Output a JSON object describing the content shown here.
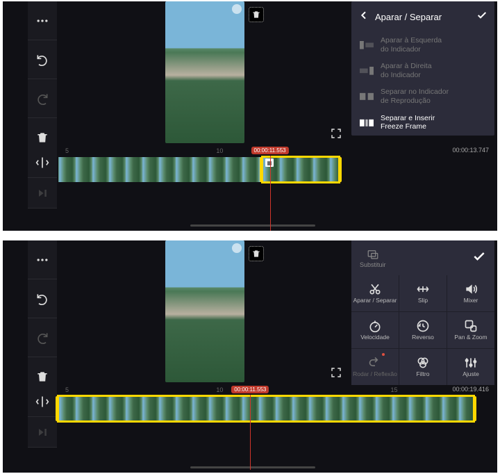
{
  "top": {
    "panel_title": "Aparar / Separar",
    "menu": [
      {
        "l1": "Aparar à Esquerda",
        "l2": "do Indicador"
      },
      {
        "l1": "Aparar à Direita",
        "l2": "do Indicador"
      },
      {
        "l1": "Separar no Indicador",
        "l2": "de Reprodução"
      },
      {
        "l1": "Separar e Inserir",
        "l2": "Freeze Frame"
      }
    ],
    "ruler": {
      "t1": "5",
      "t2": "10"
    },
    "timecode": "00:00:11.553",
    "duration": "00:00:13.747"
  },
  "bottom": {
    "header_label": "Substituir",
    "tools": {
      "aparar": "Aparar /\nSeparar",
      "slip": "Slip",
      "mixer": "Mixer",
      "velocidade": "Velocidade",
      "reverso": "Reverso",
      "panzoom": "Pan & Zoom",
      "rodar": "Rodar /\nReflexão",
      "filtro": "Filtro",
      "ajuste": "Ajuste"
    },
    "ruler": {
      "t1": "5",
      "t2": "10",
      "t3": "15"
    },
    "timecode": "00:00:11.553",
    "duration": "00:00:19.416"
  }
}
